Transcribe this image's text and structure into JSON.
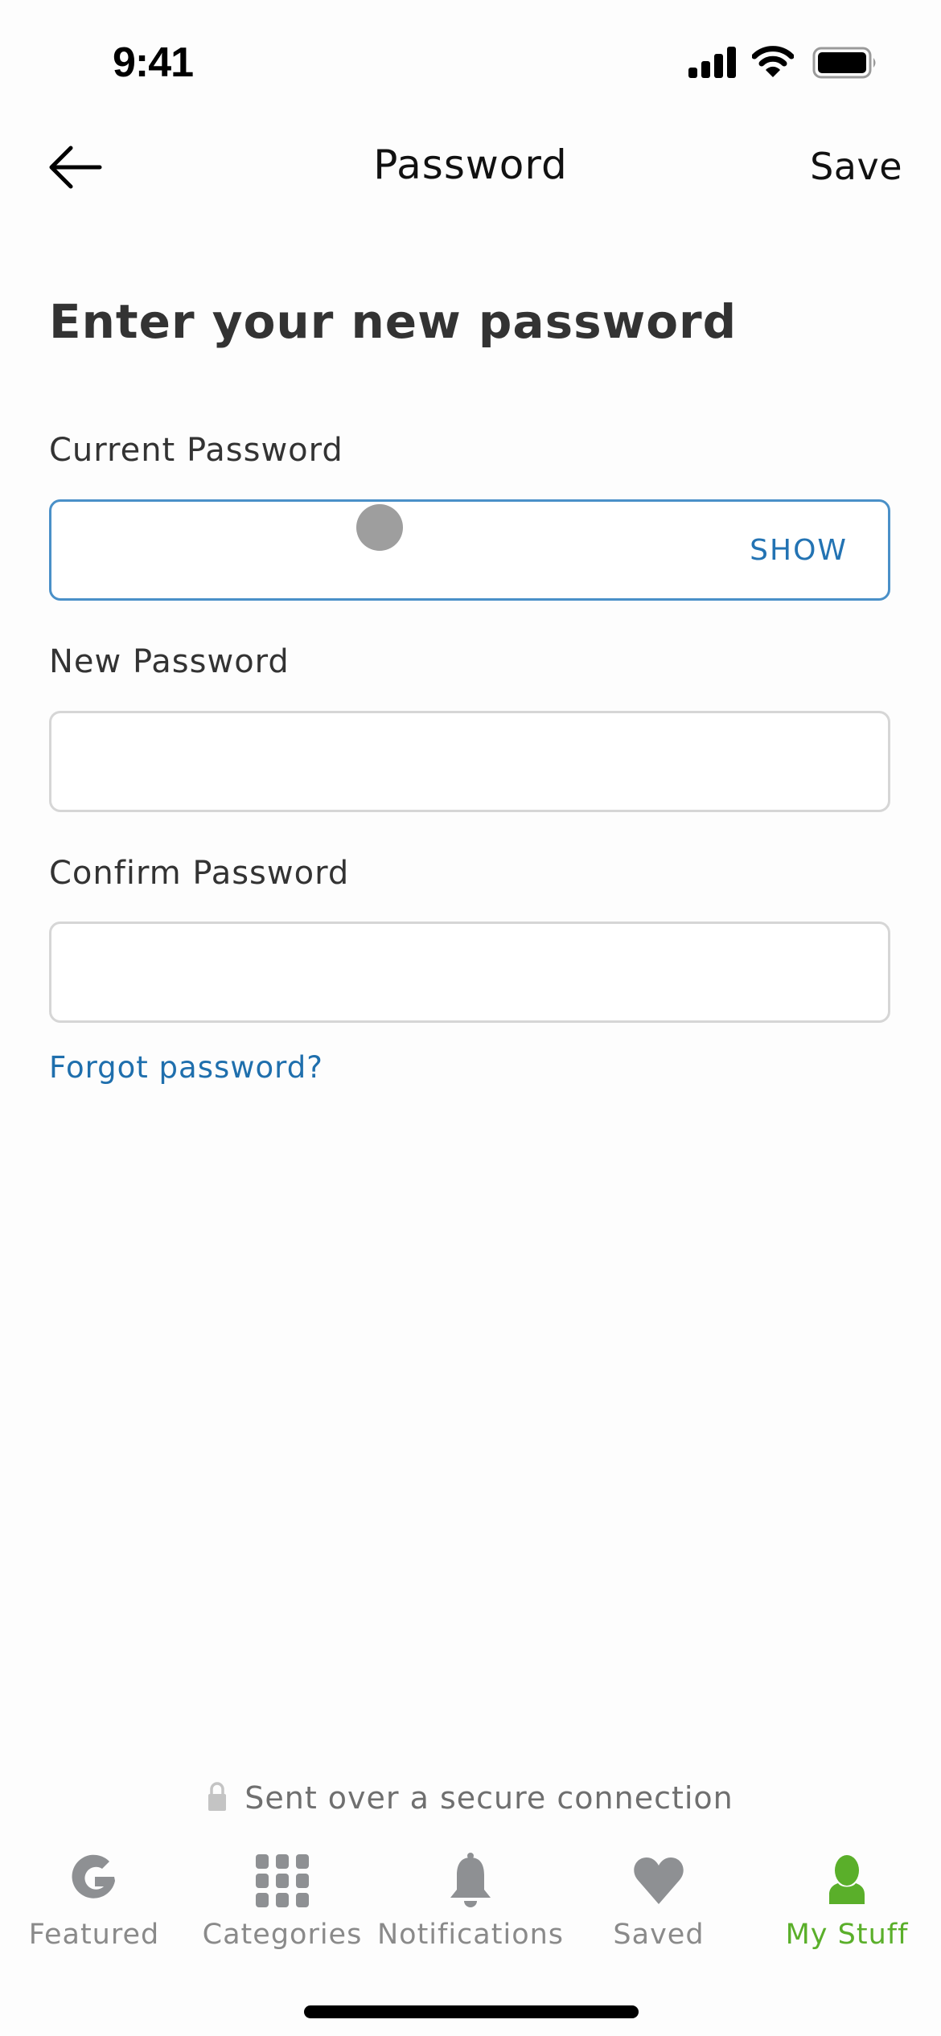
{
  "status_bar": {
    "time": "9:41",
    "icons": [
      "cellular-signal-icon",
      "wifi-icon",
      "battery-icon"
    ]
  },
  "header": {
    "back_icon": "arrow-left-icon",
    "title": "Password",
    "save_label": "Save"
  },
  "form": {
    "heading": "Enter your new password",
    "fields": [
      {
        "label": "Current Password",
        "value": "",
        "placeholder": "",
        "focused": true,
        "toggle_label": "SHOW"
      },
      {
        "label": "New Password",
        "value": "",
        "placeholder": "",
        "focused": false
      },
      {
        "label": "Confirm Password",
        "value": "",
        "placeholder": "",
        "focused": false
      }
    ],
    "forgot_link": "Forgot password?"
  },
  "secure_notice": {
    "icon": "lock-icon",
    "text": "Sent over a secure connection"
  },
  "tab_bar": {
    "active_index": 4,
    "items": [
      {
        "label": "Featured",
        "icon": "g-logo-icon"
      },
      {
        "label": "Categories",
        "icon": "grid-icon"
      },
      {
        "label": "Notifications",
        "icon": "bell-icon"
      },
      {
        "label": "Saved",
        "icon": "heart-icon"
      },
      {
        "label": "My Stuff",
        "icon": "user-icon"
      }
    ]
  },
  "colors": {
    "accent_blue": "#2373b3",
    "focus_border": "#4a90c8",
    "active_tab_green": "#5aaf2a",
    "inactive_tab_gray": "#8e9093",
    "text_dark": "#333333"
  }
}
